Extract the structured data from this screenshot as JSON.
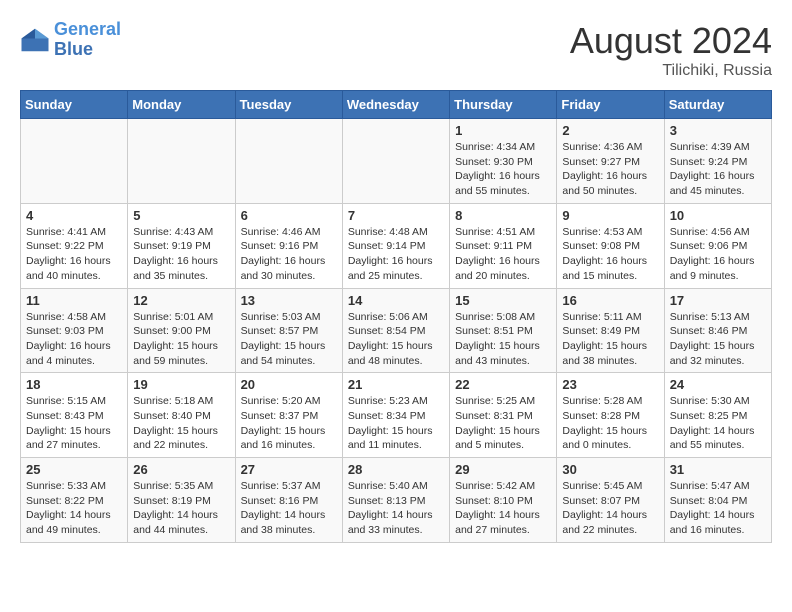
{
  "header": {
    "logo_line1": "General",
    "logo_line2": "Blue",
    "month_year": "August 2024",
    "location": "Tilichiki, Russia"
  },
  "weekdays": [
    "Sunday",
    "Monday",
    "Tuesday",
    "Wednesday",
    "Thursday",
    "Friday",
    "Saturday"
  ],
  "weeks": [
    {
      "days": [
        {
          "num": "",
          "content": ""
        },
        {
          "num": "",
          "content": ""
        },
        {
          "num": "",
          "content": ""
        },
        {
          "num": "",
          "content": ""
        },
        {
          "num": "1",
          "content": "Sunrise: 4:34 AM\nSunset: 9:30 PM\nDaylight: 16 hours\nand 55 minutes."
        },
        {
          "num": "2",
          "content": "Sunrise: 4:36 AM\nSunset: 9:27 PM\nDaylight: 16 hours\nand 50 minutes."
        },
        {
          "num": "3",
          "content": "Sunrise: 4:39 AM\nSunset: 9:24 PM\nDaylight: 16 hours\nand 45 minutes."
        }
      ]
    },
    {
      "days": [
        {
          "num": "4",
          "content": "Sunrise: 4:41 AM\nSunset: 9:22 PM\nDaylight: 16 hours\nand 40 minutes."
        },
        {
          "num": "5",
          "content": "Sunrise: 4:43 AM\nSunset: 9:19 PM\nDaylight: 16 hours\nand 35 minutes."
        },
        {
          "num": "6",
          "content": "Sunrise: 4:46 AM\nSunset: 9:16 PM\nDaylight: 16 hours\nand 30 minutes."
        },
        {
          "num": "7",
          "content": "Sunrise: 4:48 AM\nSunset: 9:14 PM\nDaylight: 16 hours\nand 25 minutes."
        },
        {
          "num": "8",
          "content": "Sunrise: 4:51 AM\nSunset: 9:11 PM\nDaylight: 16 hours\nand 20 minutes."
        },
        {
          "num": "9",
          "content": "Sunrise: 4:53 AM\nSunset: 9:08 PM\nDaylight: 16 hours\nand 15 minutes."
        },
        {
          "num": "10",
          "content": "Sunrise: 4:56 AM\nSunset: 9:06 PM\nDaylight: 16 hours\nand 9 minutes."
        }
      ]
    },
    {
      "days": [
        {
          "num": "11",
          "content": "Sunrise: 4:58 AM\nSunset: 9:03 PM\nDaylight: 16 hours\nand 4 minutes."
        },
        {
          "num": "12",
          "content": "Sunrise: 5:01 AM\nSunset: 9:00 PM\nDaylight: 15 hours\nand 59 minutes."
        },
        {
          "num": "13",
          "content": "Sunrise: 5:03 AM\nSunset: 8:57 PM\nDaylight: 15 hours\nand 54 minutes."
        },
        {
          "num": "14",
          "content": "Sunrise: 5:06 AM\nSunset: 8:54 PM\nDaylight: 15 hours\nand 48 minutes."
        },
        {
          "num": "15",
          "content": "Sunrise: 5:08 AM\nSunset: 8:51 PM\nDaylight: 15 hours\nand 43 minutes."
        },
        {
          "num": "16",
          "content": "Sunrise: 5:11 AM\nSunset: 8:49 PM\nDaylight: 15 hours\nand 38 minutes."
        },
        {
          "num": "17",
          "content": "Sunrise: 5:13 AM\nSunset: 8:46 PM\nDaylight: 15 hours\nand 32 minutes."
        }
      ]
    },
    {
      "days": [
        {
          "num": "18",
          "content": "Sunrise: 5:15 AM\nSunset: 8:43 PM\nDaylight: 15 hours\nand 27 minutes."
        },
        {
          "num": "19",
          "content": "Sunrise: 5:18 AM\nSunset: 8:40 PM\nDaylight: 15 hours\nand 22 minutes."
        },
        {
          "num": "20",
          "content": "Sunrise: 5:20 AM\nSunset: 8:37 PM\nDaylight: 15 hours\nand 16 minutes."
        },
        {
          "num": "21",
          "content": "Sunrise: 5:23 AM\nSunset: 8:34 PM\nDaylight: 15 hours\nand 11 minutes."
        },
        {
          "num": "22",
          "content": "Sunrise: 5:25 AM\nSunset: 8:31 PM\nDaylight: 15 hours\nand 5 minutes."
        },
        {
          "num": "23",
          "content": "Sunrise: 5:28 AM\nSunset: 8:28 PM\nDaylight: 15 hours\nand 0 minutes."
        },
        {
          "num": "24",
          "content": "Sunrise: 5:30 AM\nSunset: 8:25 PM\nDaylight: 14 hours\nand 55 minutes."
        }
      ]
    },
    {
      "days": [
        {
          "num": "25",
          "content": "Sunrise: 5:33 AM\nSunset: 8:22 PM\nDaylight: 14 hours\nand 49 minutes."
        },
        {
          "num": "26",
          "content": "Sunrise: 5:35 AM\nSunset: 8:19 PM\nDaylight: 14 hours\nand 44 minutes."
        },
        {
          "num": "27",
          "content": "Sunrise: 5:37 AM\nSunset: 8:16 PM\nDaylight: 14 hours\nand 38 minutes."
        },
        {
          "num": "28",
          "content": "Sunrise: 5:40 AM\nSunset: 8:13 PM\nDaylight: 14 hours\nand 33 minutes."
        },
        {
          "num": "29",
          "content": "Sunrise: 5:42 AM\nSunset: 8:10 PM\nDaylight: 14 hours\nand 27 minutes."
        },
        {
          "num": "30",
          "content": "Sunrise: 5:45 AM\nSunset: 8:07 PM\nDaylight: 14 hours\nand 22 minutes."
        },
        {
          "num": "31",
          "content": "Sunrise: 5:47 AM\nSunset: 8:04 PM\nDaylight: 14 hours\nand 16 minutes."
        }
      ]
    }
  ]
}
